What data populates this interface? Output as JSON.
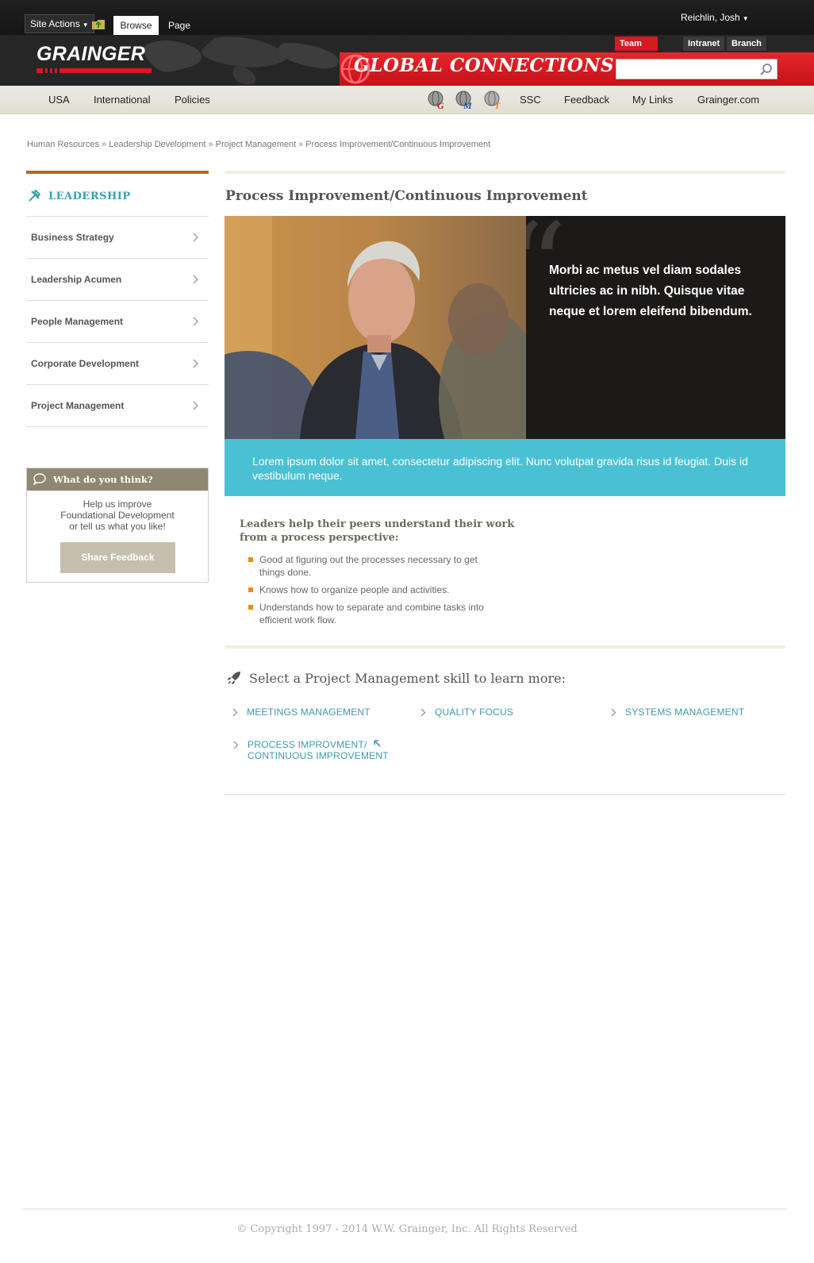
{
  "ribbon": {
    "site_actions": "Site Actions",
    "tab_browse": "Browse",
    "tab_page": "Page",
    "user": "Reichlin, Josh"
  },
  "brand": {
    "logo": "GRAINGER",
    "banner_title": "GLOBAL CONNECTIONS",
    "site_tabs": [
      "Team Member",
      "Intranet",
      "Branch"
    ],
    "search_placeholder": ""
  },
  "global_nav": {
    "left": [
      "USA",
      "International",
      "Policies"
    ],
    "gmt_icons": [
      "globe-g-icon",
      "globe-m-icon",
      "globe-t-icon"
    ],
    "right": [
      "SSC",
      "Feedback",
      "My Links",
      "Grainger.com"
    ]
  },
  "breadcrumb": [
    "Human Resources",
    "Leadership Development",
    "Project Management",
    "Process Improvement/Continuous Improvement"
  ],
  "breadcrumb_sep": "»",
  "left_nav": {
    "title": "LEADERSHIP",
    "items": [
      "Business Strategy",
      "Leadership Acumen",
      "People Management",
      "Corporate Development",
      "Project Management"
    ]
  },
  "feedback": {
    "title": "What do you think?",
    "line1": "Help us improve",
    "line2": "Foundational Development",
    "line3": "or tell us what you like!",
    "button": "Share Feedback"
  },
  "main": {
    "title": "Process Improvement/Continuous Improvement",
    "quote": "Morbi ac metus vel diam sodales ultricies ac in nibh. Quisque vitae neque et lorem eleifend bibendum.",
    "intro": "Lorem ipsum dolor sit amet, consectetur adipiscing elit. Nunc volutpat gravida risus id feugiat. Duis id vestibulum neque.",
    "lead": "Leaders help their peers understand their work from a process perspective:",
    "bullets": [
      "Good at figuring out the processes necessary to get things done.",
      "Knows how to organize people and activities.",
      "Understands how to separate and combine tasks into efficient work flow."
    ],
    "select_title": "Select a Project Management skill to learn more:",
    "skills": [
      "MEETINGS MANAGEMENT",
      "QUALITY FOCUS",
      "SYSTEMS MANAGEMENT"
    ],
    "current_skill_line1": "PROCESS IMPROVMENT/",
    "current_skill_line2": "CONTINUOUS IMPROVEMENT"
  },
  "footer": {
    "copyright": "© Copyright 1997 - 2014 W.W. Grainger, Inc. All Rights Reserved"
  },
  "colors": {
    "brand_red": "#d71920",
    "teal": "#4ac1d3",
    "link_teal": "#3e9aa8",
    "accent_orange": "#b46a1a",
    "feedback_head": "#8f8772"
  }
}
